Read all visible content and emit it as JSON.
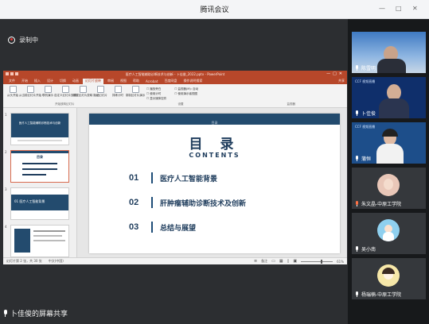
{
  "app": {
    "title": "腾讯会议"
  },
  "window_controls": [
    "—",
    "□",
    "✕"
  ],
  "recording": {
    "label": "录制中"
  },
  "powerpoint": {
    "window_title": "医疗人工智能辅助诊断技术与创新 - 卜佳俊_2022.pptx - PowerPoint",
    "tabs": [
      "文件",
      "开始",
      "插入",
      "设计",
      "切换",
      "动画",
      "幻灯片放映",
      "审阅",
      "视图",
      "帮助",
      "Acrobat",
      "百度网盘",
      "操作说明搜索",
      "共享"
    ],
    "active_tab": "幻灯片放映",
    "ribbon_buttons": [
      "从头开始",
      "从当前幻灯片开始",
      "联机演示",
      "自定义幻灯片放映",
      "设置幻灯片放映",
      "隐藏幻灯片",
      "排练计时",
      "录制幻灯片演示"
    ],
    "ribbon_checks": [
      "播放旁白",
      "使用计时",
      "显示媒体控件"
    ],
    "ribbon_monitor_label": "监视器(M): 自动",
    "ribbon_presenter_label": "使用演示者视图",
    "ribbon_groups": [
      "开始放映幻灯片",
      "设置",
      "监视器"
    ],
    "thumbnails": [
      {
        "num": "1",
        "title": "医疗人工智能辅助诊断技术与创新"
      },
      {
        "num": "2",
        "title": "目录"
      },
      {
        "num": "3",
        "title": "01 医疗人工智能背景"
      },
      {
        "num": "4",
        "title": ""
      }
    ],
    "status": {
      "slide": "幻灯片第 2 张，共 30 张",
      "lang": "中文(中国)",
      "notes": "备注",
      "zoom": "61%"
    }
  },
  "slide": {
    "caption": "目录",
    "heading": "目 录",
    "subheading": "CONTENTS",
    "items": [
      {
        "num": "01",
        "text": "医疗人工智能背景"
      },
      {
        "num": "02",
        "text": "肝肿瘤辅助诊断技术及创新"
      },
      {
        "num": "03",
        "text": "总结与展望"
      }
    ]
  },
  "share_label": "卜佳俊的屏幕共享",
  "participants": [
    {
      "name": "陈雪明",
      "type": "video",
      "muted": false
    },
    {
      "name": "卜佳俊",
      "type": "video",
      "muted": false,
      "cam_label": "CCF 视频直播"
    },
    {
      "name": "蒲恒",
      "type": "video",
      "muted": false,
      "cam_label": "CCF 视频直播"
    },
    {
      "name": "朱文晶-中原工学院",
      "type": "avatar",
      "muted": true
    },
    {
      "name": "吴小南",
      "type": "avatar",
      "muted": false
    },
    {
      "name": "杨瑞楠-中原工学院",
      "type": "avatar",
      "muted": false
    }
  ],
  "colors": {
    "ppt_accent": "#b7472a",
    "slide_navy": "#1e3c5c",
    "panel_bg": "#17191b"
  }
}
